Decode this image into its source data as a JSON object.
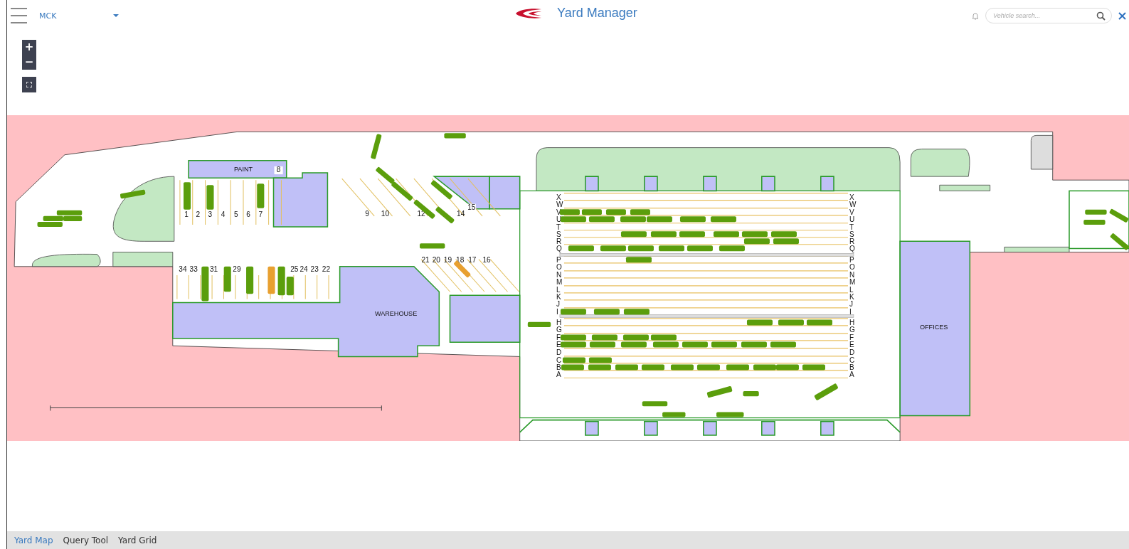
{
  "header": {
    "site": "MCK",
    "title": "Yard Manager",
    "search": {
      "placeholder": "Vehicle search..."
    }
  },
  "zoom_controls": [
    {
      "label": "+"
    },
    {
      "label": "−"
    }
  ],
  "map": {
    "labels": [
      {
        "kind": "building",
        "text": "PAINT"
      },
      {
        "kind": "building",
        "text": "WAREHOUSE"
      },
      {
        "kind": "building",
        "text": "OFFICES"
      },
      {
        "kind": "marker",
        "text": "8"
      },
      {
        "kind": "marker",
        "text": "15"
      },
      {
        "kind": "bay",
        "text": "1"
      },
      {
        "kind": "bay",
        "text": "2"
      },
      {
        "kind": "bay",
        "text": "3"
      },
      {
        "kind": "bay",
        "text": "4"
      },
      {
        "kind": "bay",
        "text": "5"
      },
      {
        "kind": "bay",
        "text": "6"
      },
      {
        "kind": "bay",
        "text": "7"
      },
      {
        "kind": "bay",
        "text": "9"
      },
      {
        "kind": "bay",
        "text": "10"
      },
      {
        "kind": "bay",
        "text": "12"
      },
      {
        "kind": "bay",
        "text": "14"
      },
      {
        "kind": "bay",
        "text": "34"
      },
      {
        "kind": "bay",
        "text": "33"
      },
      {
        "kind": "bay",
        "text": "31"
      },
      {
        "kind": "bay",
        "text": "29"
      },
      {
        "kind": "bay",
        "text": "25"
      },
      {
        "kind": "bay",
        "text": "24"
      },
      {
        "kind": "bay",
        "text": "23"
      },
      {
        "kind": "bay",
        "text": "22"
      },
      {
        "kind": "bay",
        "text": "21"
      },
      {
        "kind": "bay",
        "text": "20"
      },
      {
        "kind": "bay",
        "text": "19"
      },
      {
        "kind": "bay",
        "text": "18"
      },
      {
        "kind": "bay",
        "text": "17"
      },
      {
        "kind": "bay",
        "text": "16"
      }
    ],
    "rows": [
      {
        "label_left": "X",
        "label_right": "X"
      },
      {
        "label_left": "W",
        "label_right": "W"
      },
      {
        "label_left": "V",
        "label_right": "V",
        "vehicles": [
          {
            "color": "#5b9e0c"
          },
          {
            "color": "#5b9e0c"
          },
          {
            "color": "#5b9e0c"
          },
          {
            "color": "#5b9e0c"
          }
        ]
      },
      {
        "label_left": "U",
        "label_right": "U",
        "vehicles": [
          {
            "color": "#5b9e0c"
          },
          {
            "color": "#5b9e0c"
          },
          {
            "color": "#5b9e0c"
          },
          {
            "color": "#5b9e0c"
          },
          {
            "color": "#5b9e0c"
          },
          {
            "color": "#5b9e0c"
          }
        ]
      },
      {
        "label_left": "T",
        "label_right": "T"
      },
      {
        "label_left": "S",
        "label_right": "S",
        "vehicles": [
          {
            "color": "#5b9e0c"
          },
          {
            "color": "#5b9e0c"
          },
          {
            "color": "#5b9e0c"
          },
          {
            "color": "#5b9e0c"
          },
          {
            "color": "#5b9e0c"
          },
          {
            "color": "#5b9e0c"
          }
        ]
      },
      {
        "label_left": "R",
        "label_right": "R",
        "vehicles": [
          {
            "color": "#5b9e0c"
          },
          {
            "color": "#5b9e0c"
          }
        ]
      },
      {
        "label_left": "Q",
        "label_right": "Q",
        "vehicles": [
          {
            "color": "#5b9e0c"
          },
          {
            "color": "#5b9e0c"
          },
          {
            "color": "#5b9e0c"
          },
          {
            "color": "#5b9e0c"
          },
          {
            "color": "#5b9e0c"
          },
          {
            "color": "#5b9e0c"
          }
        ]
      },
      {
        "label_left": "P",
        "label_right": "P",
        "vehicles": [
          {
            "color": "#5b9e0c"
          }
        ]
      },
      {
        "label_left": "O",
        "label_right": "O"
      },
      {
        "label_left": "N",
        "label_right": "N"
      },
      {
        "label_left": "M",
        "label_right": "M"
      },
      {
        "label_left": "L",
        "label_right": "L"
      },
      {
        "label_left": "K",
        "label_right": "K"
      },
      {
        "label_left": "J",
        "label_right": "J"
      },
      {
        "label_left": "I",
        "label_right": "I",
        "vehicles": [
          {
            "color": "#5b9e0c"
          },
          {
            "color": "#5b9e0c"
          },
          {
            "color": "#5b9e0c"
          }
        ]
      },
      {
        "label_left": "H",
        "label_right": "H",
        "vehicles": [
          {
            "color": "#5b9e0c"
          },
          {
            "color": "#5b9e0c"
          },
          {
            "color": "#5b9e0c"
          }
        ]
      },
      {
        "label_left": "G",
        "label_right": "G"
      },
      {
        "label_left": "F",
        "label_right": "F",
        "vehicles": [
          {
            "color": "#5b9e0c"
          },
          {
            "color": "#5b9e0c"
          },
          {
            "color": "#5b9e0c"
          },
          {
            "color": "#5b9e0c"
          }
        ]
      },
      {
        "label_left": "E",
        "label_right": "E",
        "vehicles": [
          {
            "color": "#5b9e0c"
          },
          {
            "color": "#5b9e0c"
          },
          {
            "color": "#5b9e0c"
          },
          {
            "color": "#5b9e0c"
          },
          {
            "color": "#5b9e0c"
          },
          {
            "color": "#5b9e0c"
          },
          {
            "color": "#5b9e0c"
          },
          {
            "color": "#5b9e0c"
          }
        ]
      },
      {
        "label_left": "D",
        "label_right": "D"
      },
      {
        "label_left": "C",
        "label_right": "C",
        "vehicles": [
          {
            "color": "#5b9e0c"
          },
          {
            "color": "#5b9e0c"
          }
        ]
      },
      {
        "label_left": "B",
        "label_right": "B",
        "vehicles": [
          {
            "color": "#5b9e0c"
          },
          {
            "color": "#5b9e0c"
          },
          {
            "color": "#5b9e0c"
          },
          {
            "color": "#5b9e0c"
          },
          {
            "color": "#5b9e0c"
          },
          {
            "color": "#5b9e0c"
          },
          {
            "color": "#5b9e0c"
          },
          {
            "color": "#5b9e0c"
          },
          {
            "color": "#5b9e0c"
          },
          {
            "color": "#5b9e0c"
          }
        ]
      },
      {
        "label_left": "A",
        "label_right": "A"
      }
    ],
    "vehicles": [
      {
        "color": "#5b9e0c"
      },
      {
        "color": "#5b9e0c"
      },
      {
        "color": "#5b9e0c"
      },
      {
        "color": "#5b9e0c"
      },
      {
        "color": "#5b9e0c"
      },
      {
        "color": "#5b9e0c"
      },
      {
        "color": "#5b9e0c"
      },
      {
        "color": "#5b9e0c"
      },
      {
        "color": "#5b9e0c"
      },
      {
        "color": "#5b9e0c"
      },
      {
        "color": "#5b9e0c"
      },
      {
        "color": "#5b9e0c"
      },
      {
        "color": "#5b9e0c"
      },
      {
        "color": "#5b9e0c"
      },
      {
        "color": "#5b9e0c"
      },
      {
        "color": "#5b9e0c"
      },
      {
        "color": "#5b9e0c"
      },
      {
        "color": "#5b9e0c"
      },
      {
        "color": "#5b9e0c"
      },
      {
        "color": "#5b9e0c"
      },
      {
        "color": "#5b9e0c"
      },
      {
        "color": "#5b9e0c"
      },
      {
        "color": "#5b9e0c"
      },
      {
        "color": "#5b9e0c"
      },
      {
        "color": "#5b9e0c"
      },
      {
        "color": "#5b9e0c"
      },
      {
        "color": "#5b9e0c"
      },
      {
        "color": "#5b9e0c"
      },
      {
        "color": "#5b9e0c"
      },
      {
        "color": "#e8a030"
      },
      {
        "color": "#5b9e0c"
      },
      {
        "color": "#5b9e0c"
      },
      {
        "color": "#5b9e0c"
      },
      {
        "color": "#e8a030"
      }
    ]
  },
  "tabs": [
    {
      "label": "Yard Map",
      "selected": true
    },
    {
      "label": "Query Tool",
      "selected": false
    },
    {
      "label": "Yard Grid",
      "selected": false
    }
  ]
}
